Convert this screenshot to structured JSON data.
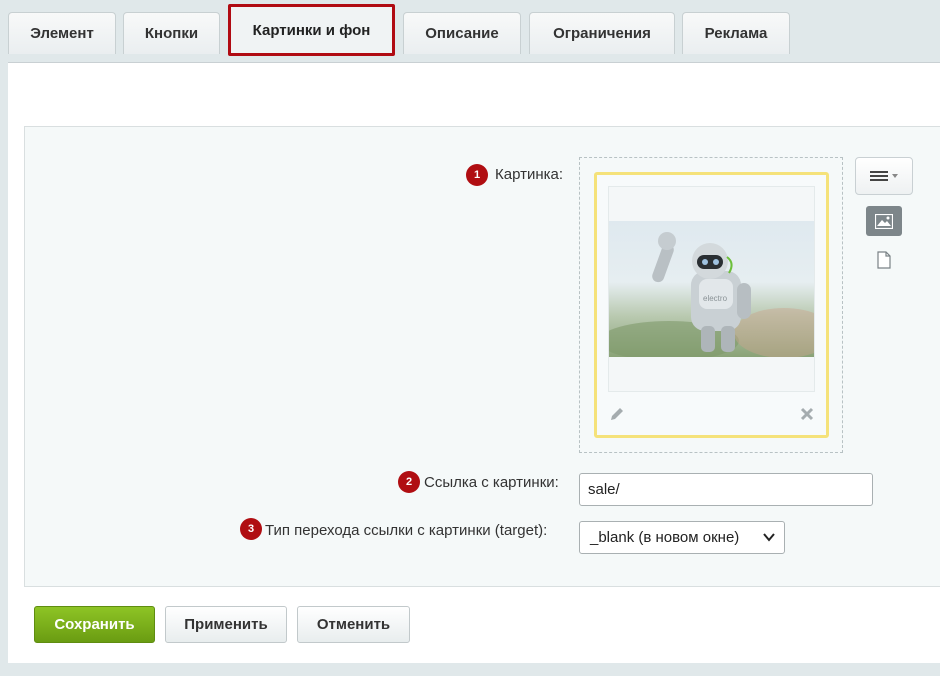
{
  "tabs": [
    {
      "label": "Элемент"
    },
    {
      "label": "Кнопки"
    },
    {
      "label": "Картинки и фон"
    },
    {
      "label": "Описание"
    },
    {
      "label": "Ограничения"
    },
    {
      "label": "Реклама"
    }
  ],
  "active_tab": "Картинки и фон",
  "form": {
    "picture": {
      "number": "1",
      "label": "Картинка:"
    },
    "link": {
      "number": "2",
      "label": "Ссылка с картинки:",
      "value": "sale/"
    },
    "target": {
      "number": "3",
      "label": "Тип перехода ссылки с картинки (target):",
      "value": "_blank (в новом окне)"
    }
  },
  "image_caption": "electro",
  "buttons": {
    "save": "Сохранить",
    "apply": "Применить",
    "cancel": "Отменить"
  },
  "colors": {
    "accent": "#b00a12",
    "primary_button": "#7cb51b",
    "image_frame": "#f5e27a"
  }
}
